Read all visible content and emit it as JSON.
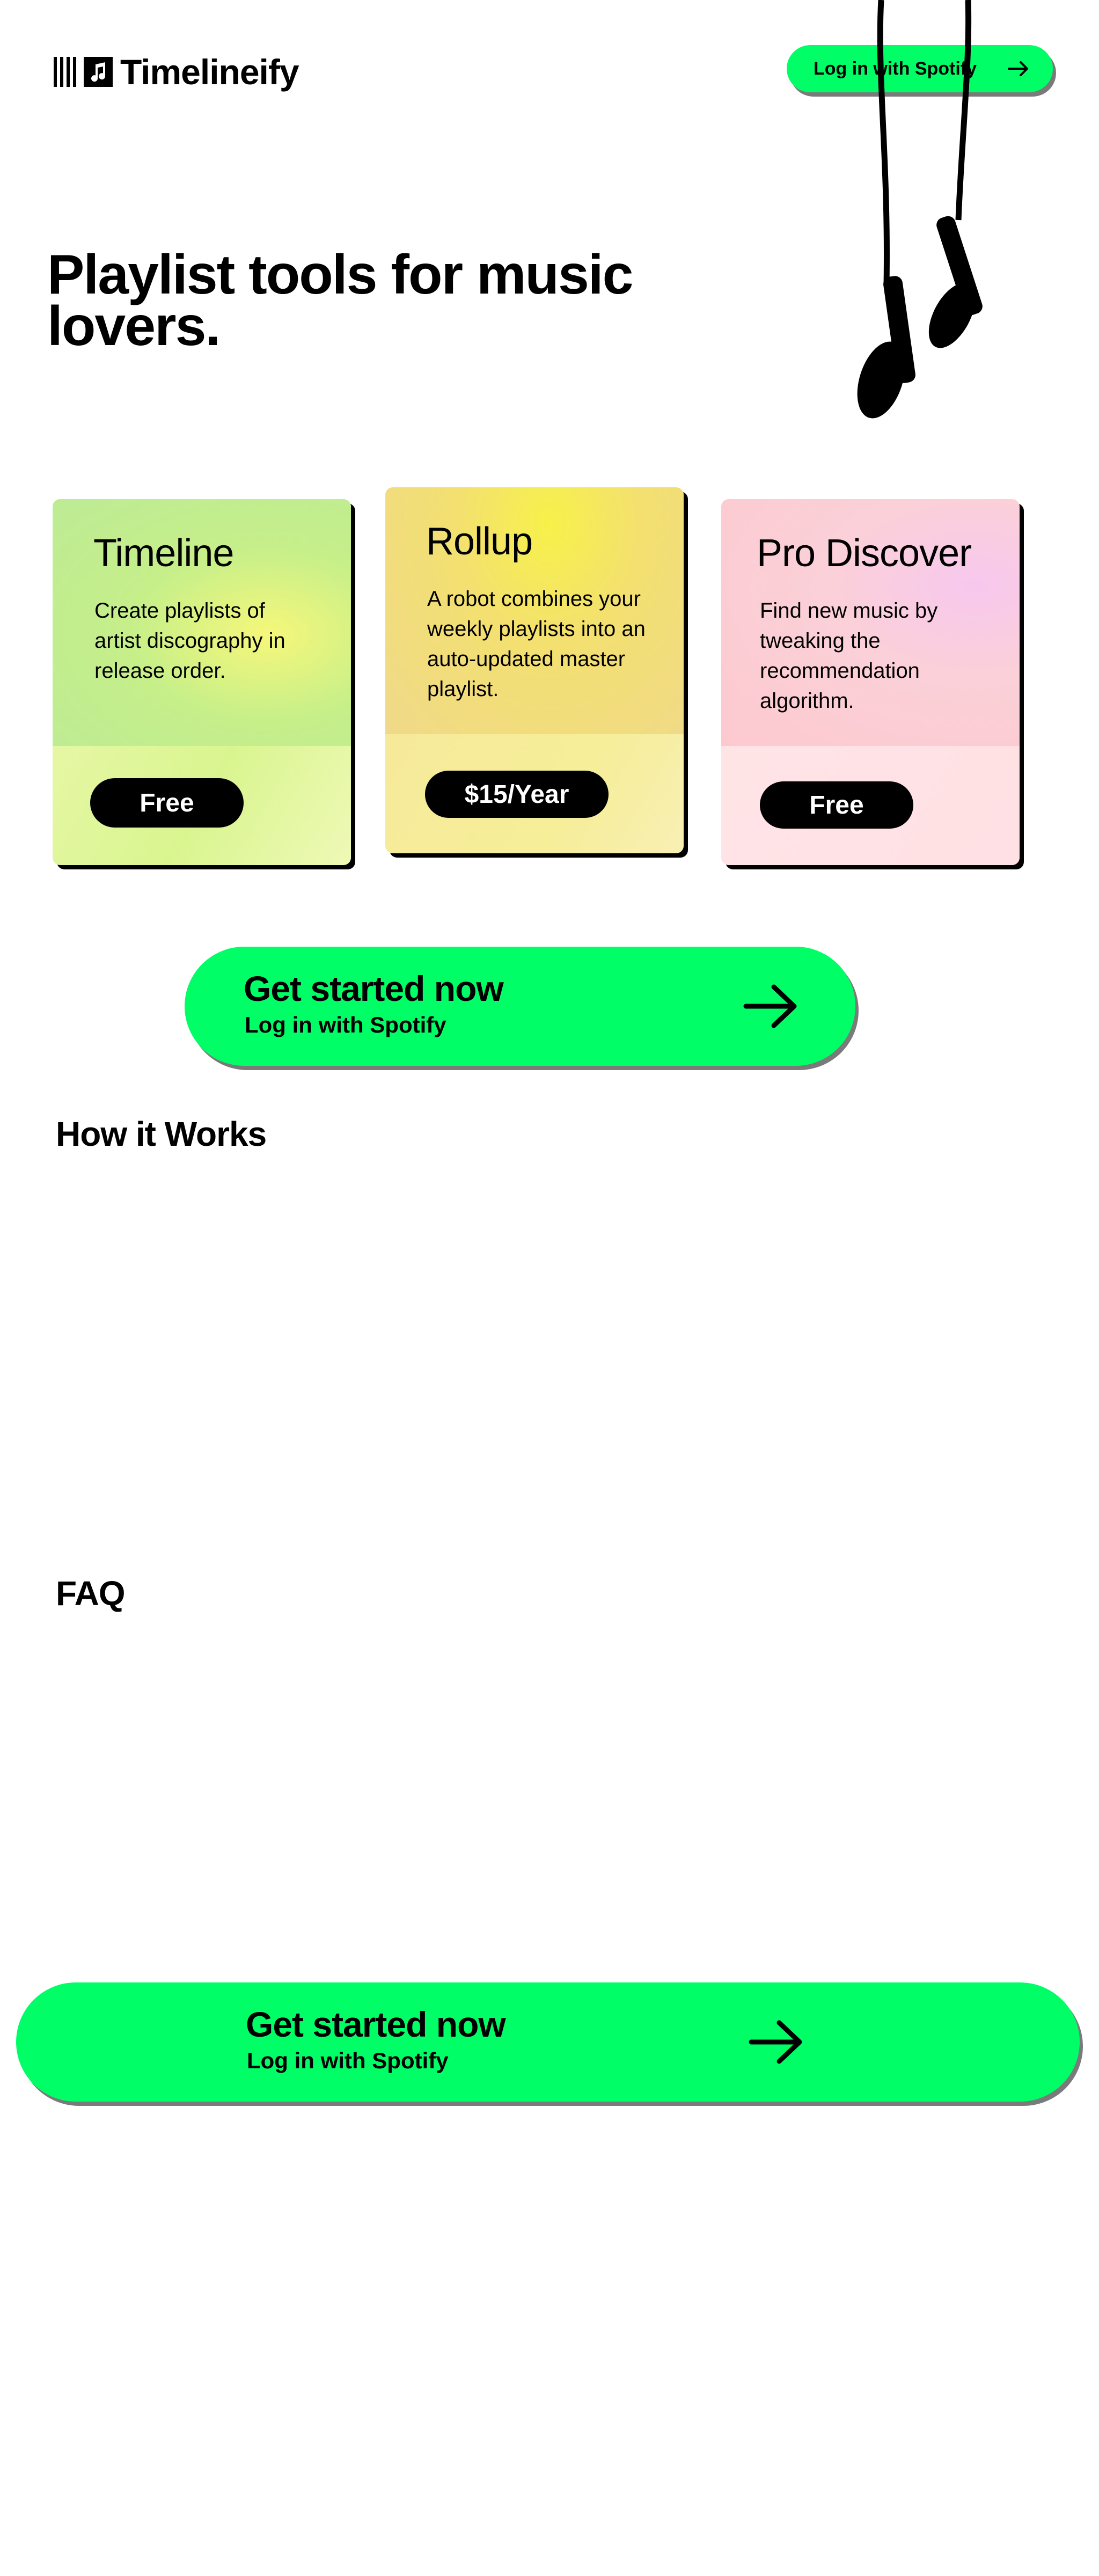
{
  "header": {
    "logo_text": "Timelineify",
    "login_label": "Log in with Spotify"
  },
  "hero": {
    "title": "Playlist tools for music lovers."
  },
  "cards": [
    {
      "title": "Timeline",
      "description": "Create playlists of artist discography in release order.",
      "price": "Free"
    },
    {
      "title": "Rollup",
      "description": "A robot combines your weekly playlists into an auto-updated master playlist.",
      "price": "$15/Year"
    },
    {
      "title": "Pro Discover",
      "description": "Find new music by tweaking the recommendation algorithm.",
      "price": "Free"
    }
  ],
  "cta": {
    "title": "Get started now",
    "subtitle": "Log in with Spotify"
  },
  "sections": {
    "how_it_works": "How it Works",
    "faq": "FAQ"
  },
  "icons": {
    "logo": "bars-music-note-icon",
    "arrow": "arrow-right-icon",
    "illustration": "earbuds-icon"
  },
  "colors": {
    "accent": "#00ff66",
    "text": "#000000",
    "background": "#ffffff"
  }
}
